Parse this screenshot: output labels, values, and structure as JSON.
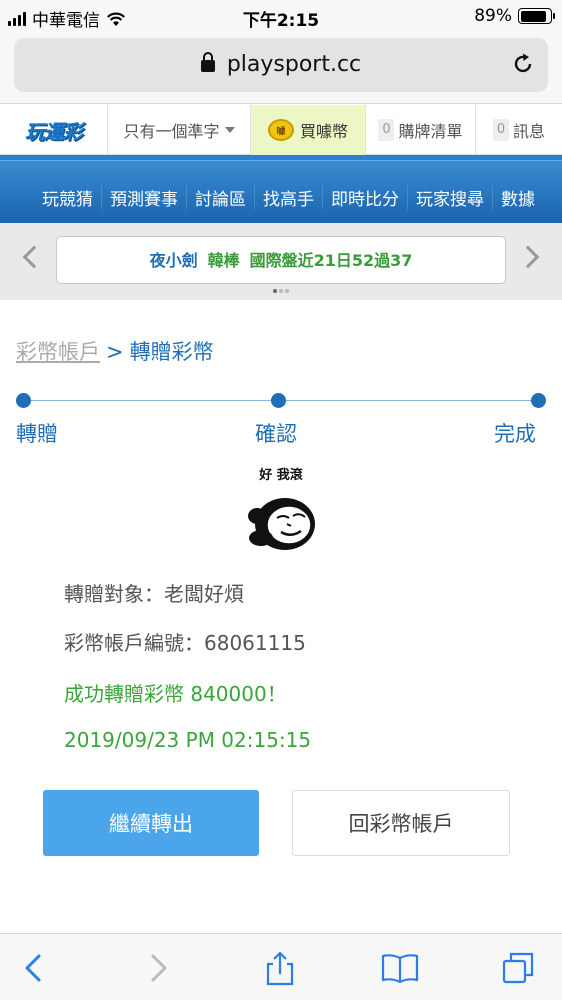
{
  "status_bar": {
    "carrier": "中華電信",
    "time": "下午2:15",
    "battery_percent": "89%",
    "battery_level": 0.89
  },
  "browser": {
    "url": "playsport.cc",
    "icons": [
      "lock-icon",
      "reload-icon"
    ]
  },
  "site_header": {
    "logo_text": "玩運彩",
    "username": "只有一個準字",
    "buy_coins": "買噱幣",
    "coin_icon_text": "噱",
    "cart_count": "0",
    "cart_label": "購牌清單",
    "msg_count": "0",
    "msg_label": "訊息"
  },
  "nav": {
    "items": [
      "玩競猜",
      "預測賽事",
      "討論區",
      "找高手",
      "即時比分",
      "玩家搜尋",
      "數據"
    ]
  },
  "ticker": {
    "name": "夜小劍",
    "team": "韓棒",
    "record": "國際盤近21日52過37"
  },
  "breadcrumb": {
    "root": "彩幣帳戶",
    "separator": ">",
    "current": "轉贈彩幣"
  },
  "steps": {
    "items": [
      "轉贈",
      "確認",
      "完成"
    ]
  },
  "meme": {
    "caption": "好 我滾"
  },
  "result": {
    "target": "轉贈對象：老闆好煩",
    "account": "彩幣帳戶編號：68061115",
    "success": "成功轉贈彩幣 840000！",
    "datetime": "2019/09/23 PM 02:15:15"
  },
  "buttons": {
    "continue": "繼續轉出",
    "back_to_account": "回彩幣帳戶"
  },
  "colors": {
    "accent_blue": "#1f6fb7",
    "button_blue": "#4ba5ea",
    "success_green": "#3aa53a",
    "nav_blue": "#2a79c6"
  }
}
